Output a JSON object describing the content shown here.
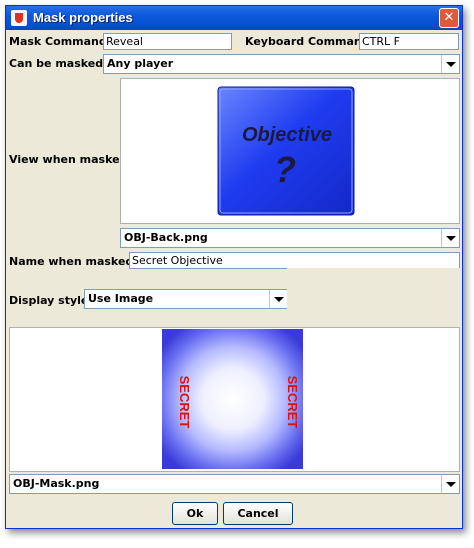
{
  "window": {
    "title": "Mask properties",
    "close_glyph": "✕"
  },
  "mask_command": {
    "label": "Mask Command:",
    "value": "Reveal"
  },
  "keyboard_command": {
    "label": "Keyboard Command:",
    "value": "CTRL F"
  },
  "masked_by": {
    "label": "Can be masked by:",
    "selected": "Any player"
  },
  "view_masked": {
    "label": "View when masked:",
    "image_text": "Objective",
    "image_symbol": "?",
    "image_file": "OBJ-Back.png"
  },
  "name_masked": {
    "label": "Name when masked:",
    "value": "Secret Objective"
  },
  "display_style": {
    "label": "Display style:",
    "selected": "Use Image"
  },
  "mask_image": {
    "side_text": "SECRET",
    "file": "OBJ-Mask.png"
  },
  "buttons": {
    "ok": "Ok",
    "cancel": "Cancel"
  },
  "colors": {
    "title_bar": "#0a58dd",
    "dialog_bg": "#ece9d8",
    "objective_blue": "#1f3cf0",
    "secret_red": "#dd1111"
  }
}
